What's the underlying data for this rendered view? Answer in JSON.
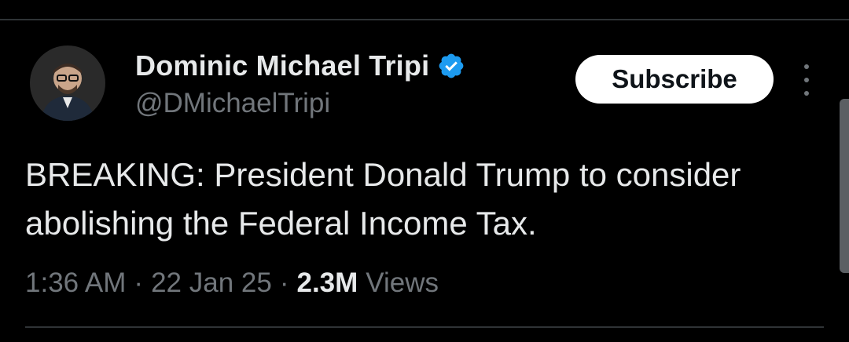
{
  "tweet": {
    "author": {
      "display_name": "Dominic Michael Tripi",
      "handle": "@DMichaelTripi",
      "verified": true
    },
    "subscribe_label": "Subscribe",
    "text": "BREAKING: President Donald Trump to consider abolishing the Federal Income Tax.",
    "meta": {
      "time": "1:36 AM",
      "separator": "·",
      "date": "22 Jan 25",
      "views_count": "2.3M",
      "views_label": "Views"
    }
  },
  "colors": {
    "background": "#000000",
    "primary_text": "#e7e9ea",
    "secondary_text": "#71767b",
    "verified_blue": "#1d9bf0",
    "subscribe_bg": "#ffffff",
    "divider": "#2f3336"
  },
  "icons": {
    "verified": "verified-badge-icon",
    "more": "more-vertical-icon"
  }
}
